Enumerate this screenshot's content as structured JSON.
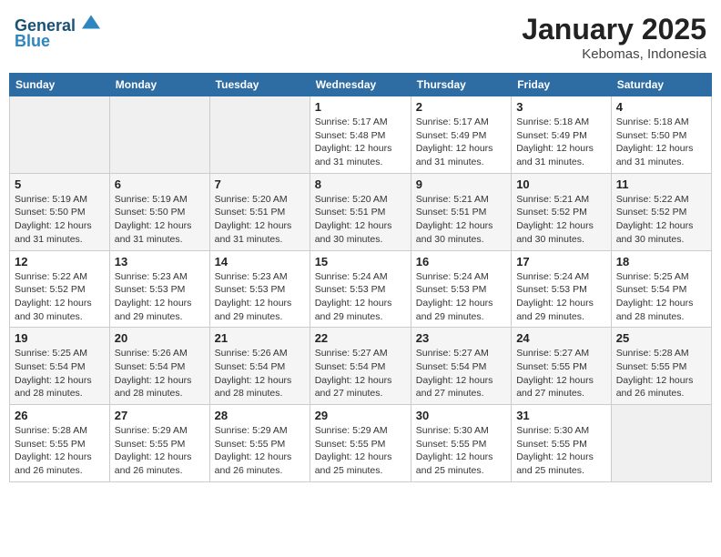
{
  "header": {
    "logo_line1": "General",
    "logo_line2": "Blue",
    "month_title": "January 2025",
    "location": "Kebomas, Indonesia"
  },
  "weekdays": [
    "Sunday",
    "Monday",
    "Tuesday",
    "Wednesday",
    "Thursday",
    "Friday",
    "Saturday"
  ],
  "weeks": [
    [
      {
        "day": "",
        "info": ""
      },
      {
        "day": "",
        "info": ""
      },
      {
        "day": "",
        "info": ""
      },
      {
        "day": "1",
        "info": "Sunrise: 5:17 AM\nSunset: 5:48 PM\nDaylight: 12 hours\nand 31 minutes."
      },
      {
        "day": "2",
        "info": "Sunrise: 5:17 AM\nSunset: 5:49 PM\nDaylight: 12 hours\nand 31 minutes."
      },
      {
        "day": "3",
        "info": "Sunrise: 5:18 AM\nSunset: 5:49 PM\nDaylight: 12 hours\nand 31 minutes."
      },
      {
        "day": "4",
        "info": "Sunrise: 5:18 AM\nSunset: 5:50 PM\nDaylight: 12 hours\nand 31 minutes."
      }
    ],
    [
      {
        "day": "5",
        "info": "Sunrise: 5:19 AM\nSunset: 5:50 PM\nDaylight: 12 hours\nand 31 minutes."
      },
      {
        "day": "6",
        "info": "Sunrise: 5:19 AM\nSunset: 5:50 PM\nDaylight: 12 hours\nand 31 minutes."
      },
      {
        "day": "7",
        "info": "Sunrise: 5:20 AM\nSunset: 5:51 PM\nDaylight: 12 hours\nand 31 minutes."
      },
      {
        "day": "8",
        "info": "Sunrise: 5:20 AM\nSunset: 5:51 PM\nDaylight: 12 hours\nand 30 minutes."
      },
      {
        "day": "9",
        "info": "Sunrise: 5:21 AM\nSunset: 5:51 PM\nDaylight: 12 hours\nand 30 minutes."
      },
      {
        "day": "10",
        "info": "Sunrise: 5:21 AM\nSunset: 5:52 PM\nDaylight: 12 hours\nand 30 minutes."
      },
      {
        "day": "11",
        "info": "Sunrise: 5:22 AM\nSunset: 5:52 PM\nDaylight: 12 hours\nand 30 minutes."
      }
    ],
    [
      {
        "day": "12",
        "info": "Sunrise: 5:22 AM\nSunset: 5:52 PM\nDaylight: 12 hours\nand 30 minutes."
      },
      {
        "day": "13",
        "info": "Sunrise: 5:23 AM\nSunset: 5:53 PM\nDaylight: 12 hours\nand 29 minutes."
      },
      {
        "day": "14",
        "info": "Sunrise: 5:23 AM\nSunset: 5:53 PM\nDaylight: 12 hours\nand 29 minutes."
      },
      {
        "day": "15",
        "info": "Sunrise: 5:24 AM\nSunset: 5:53 PM\nDaylight: 12 hours\nand 29 minutes."
      },
      {
        "day": "16",
        "info": "Sunrise: 5:24 AM\nSunset: 5:53 PM\nDaylight: 12 hours\nand 29 minutes."
      },
      {
        "day": "17",
        "info": "Sunrise: 5:24 AM\nSunset: 5:53 PM\nDaylight: 12 hours\nand 29 minutes."
      },
      {
        "day": "18",
        "info": "Sunrise: 5:25 AM\nSunset: 5:54 PM\nDaylight: 12 hours\nand 28 minutes."
      }
    ],
    [
      {
        "day": "19",
        "info": "Sunrise: 5:25 AM\nSunset: 5:54 PM\nDaylight: 12 hours\nand 28 minutes."
      },
      {
        "day": "20",
        "info": "Sunrise: 5:26 AM\nSunset: 5:54 PM\nDaylight: 12 hours\nand 28 minutes."
      },
      {
        "day": "21",
        "info": "Sunrise: 5:26 AM\nSunset: 5:54 PM\nDaylight: 12 hours\nand 28 minutes."
      },
      {
        "day": "22",
        "info": "Sunrise: 5:27 AM\nSunset: 5:54 PM\nDaylight: 12 hours\nand 27 minutes."
      },
      {
        "day": "23",
        "info": "Sunrise: 5:27 AM\nSunset: 5:54 PM\nDaylight: 12 hours\nand 27 minutes."
      },
      {
        "day": "24",
        "info": "Sunrise: 5:27 AM\nSunset: 5:55 PM\nDaylight: 12 hours\nand 27 minutes."
      },
      {
        "day": "25",
        "info": "Sunrise: 5:28 AM\nSunset: 5:55 PM\nDaylight: 12 hours\nand 26 minutes."
      }
    ],
    [
      {
        "day": "26",
        "info": "Sunrise: 5:28 AM\nSunset: 5:55 PM\nDaylight: 12 hours\nand 26 minutes."
      },
      {
        "day": "27",
        "info": "Sunrise: 5:29 AM\nSunset: 5:55 PM\nDaylight: 12 hours\nand 26 minutes."
      },
      {
        "day": "28",
        "info": "Sunrise: 5:29 AM\nSunset: 5:55 PM\nDaylight: 12 hours\nand 26 minutes."
      },
      {
        "day": "29",
        "info": "Sunrise: 5:29 AM\nSunset: 5:55 PM\nDaylight: 12 hours\nand 25 minutes."
      },
      {
        "day": "30",
        "info": "Sunrise: 5:30 AM\nSunset: 5:55 PM\nDaylight: 12 hours\nand 25 minutes."
      },
      {
        "day": "31",
        "info": "Sunrise: 5:30 AM\nSunset: 5:55 PM\nDaylight: 12 hours\nand 25 minutes."
      },
      {
        "day": "",
        "info": ""
      }
    ]
  ]
}
